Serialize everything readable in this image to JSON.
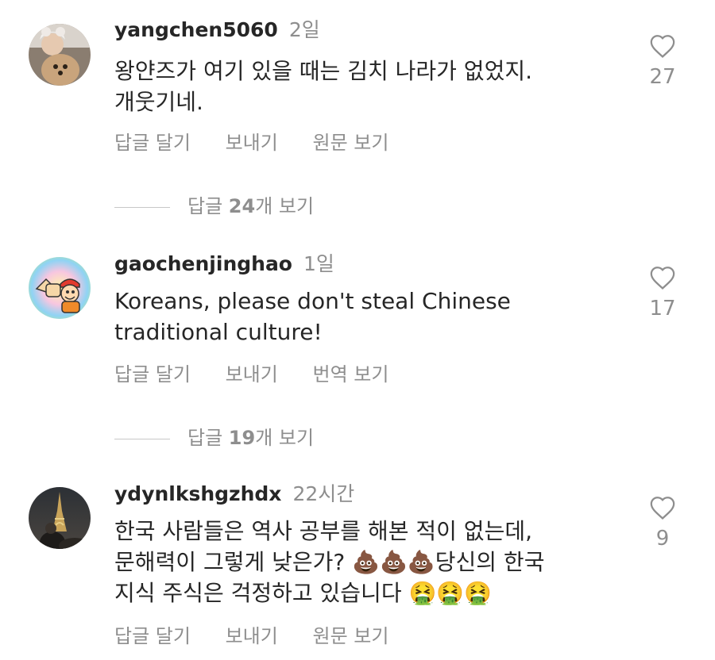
{
  "comments": [
    {
      "username": "yangchen5060",
      "age": "2일",
      "lines": [
        "왕얀즈가 여기 있을 때는 김치 나라가 없었지.",
        "개웃기네."
      ],
      "likes": "27",
      "actions": [
        "답글 달기",
        "보내기",
        "원문 보기"
      ],
      "replies": {
        "prefix": "답글 ",
        "count": "24",
        "suffix": "개 보기"
      }
    },
    {
      "username": "gaochenjinghao",
      "age": "1일",
      "lines": [
        "Koreans, please don't steal Chinese",
        "traditional culture!"
      ],
      "likes": "17",
      "actions": [
        "답글 달기",
        "보내기",
        "번역 보기"
      ],
      "replies": {
        "prefix": "답글 ",
        "count": "19",
        "suffix": "개 보기"
      }
    },
    {
      "username": "ydynlkshgzhdx",
      "age": "22시간",
      "lines": [
        "한국 사람들은 역사 공부를 해본 적이 없는데,",
        "문해력이 그렇게 낮은가? 💩💩💩당신의 한국",
        "지식 주식은 걱정하고 있습니다 🤮🤮🤮"
      ],
      "likes": "9",
      "actions": [
        "답글 달기",
        "보내기",
        "원문 보기"
      ]
    }
  ],
  "icons": {
    "like": "heart-outline-icon"
  },
  "colors": {
    "text": "#262626",
    "muted": "#8e8e8e",
    "background": "#ffffff"
  }
}
